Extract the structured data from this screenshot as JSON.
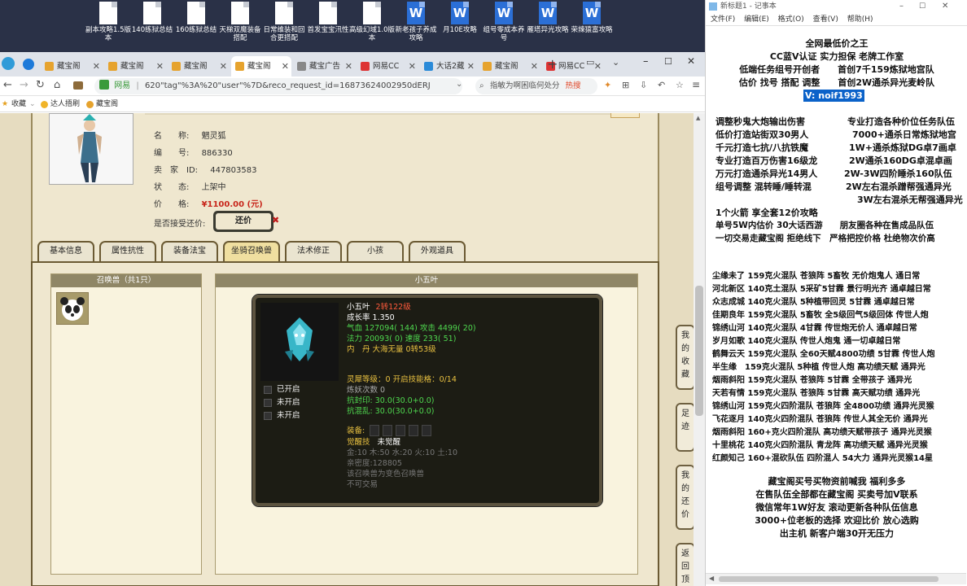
{
  "desktop": {
    "icons": [
      {
        "label": "副本攻略1.5版本",
        "type": "doc"
      },
      {
        "label": "140练狱总结",
        "type": "doc"
      },
      {
        "label": "160练狱总结",
        "type": "doc"
      },
      {
        "label": "天梯双魔装备搭配",
        "type": "doc"
      },
      {
        "label": "日常维装和回合更搭配",
        "type": "doc"
      },
      {
        "label": "首发宝宝汛性",
        "type": "doc"
      },
      {
        "label": "高级幻域1.0版本",
        "type": "doc"
      },
      {
        "label": "新老孩子养成攻略",
        "type": "word"
      },
      {
        "label": "月10E攻略",
        "type": "word"
      },
      {
        "label": "组号零成本养号",
        "type": "word"
      },
      {
        "label": "雁塔异光攻略",
        "type": "word"
      },
      {
        "label": "荣辣猿富攻略",
        "type": "word"
      }
    ]
  },
  "browser": {
    "tabs": [
      {
        "label": "藏宝阁"
      },
      {
        "label": "藏宝阁"
      },
      {
        "label": "藏宝阁"
      },
      {
        "label": "藏宝阁"
      },
      {
        "label": "藏宝广告"
      },
      {
        "label": "网易CC"
      },
      {
        "label": "大话2藏"
      },
      {
        "label": "藏宝阁"
      },
      {
        "label": "网易CC"
      }
    ],
    "new_tab": "+",
    "url": "620\"tag\"%3A%20\"user\"%7D&reco_request_id=16873624002950dERJ",
    "site_label": "网易",
    "search_placeholder": "指敏为啊困临何处分",
    "search_hot": "热搜",
    "bookmarks": {
      "star": "收藏",
      "b1": "达人捂刷",
      "b2": "藏宝阁"
    }
  },
  "item": {
    "name_label": "名　　称:",
    "name_value": "魍灵狐",
    "id_label": "编　　号:",
    "id_value": "886330",
    "seller_label": "卖　家　ID:",
    "seller_value": "447803583",
    "status_label": "状　　态:",
    "status_value": "上架中",
    "price_label": "价　　格:",
    "price_value": "¥1100.00 (元)",
    "counter_label": "是否接受还价:",
    "counter_btn": "还价"
  },
  "game_tabs": [
    "基本信息",
    "属性抗性",
    "装备法宝",
    "坐骑召唤兽",
    "法术修正",
    "小孩",
    "外观道具"
  ],
  "active_tab": "坐骑召唤兽",
  "summon_list": {
    "header": "召唤兽（共1只）"
  },
  "pet": {
    "panel_title": "小五叶",
    "name": "小五叶",
    "level": "2转122级",
    "growth": "成长率 1.350",
    "hp": "气血 127094( 144) 攻击 4499( 20)",
    "mp": "法力 20093( 0) 速度 233( 51)",
    "neidan": "内　丹 大海无量 0转53级",
    "slots": [
      "已开启",
      "未开启",
      "未开启"
    ],
    "spirit": "灵犀等级：0 开启技能格：0/14",
    "refine": "炼妖次数 0",
    "resist1": "抗封印: 30.0(30.0+0.0)",
    "resist2": "抗混乱: 30.0(30.0+0.0)",
    "equip_label": "装备:",
    "awaken_label": "觉醒技",
    "awaken_value": "未觉醒",
    "elements": "金:10 木:50 水:20 火:10 土:10",
    "bonus": "亲密度:128805",
    "note1": "该召唤兽为变色召唤兽",
    "note2": "不可交易"
  },
  "side_buttons": [
    "我的收藏",
    "足迹",
    "我的还价",
    "返回顶部"
  ],
  "notepad": {
    "title": "新标题1 - 记事本",
    "menu": [
      "文件(F)",
      "编辑(E)",
      "格式(O)",
      "查看(V)",
      "帮助(H)"
    ],
    "header_lines": [
      "全网最低价之王",
      "CC蓝V认证 实力担保 老牌工作室",
      "低端任务组号开创者　　首创7千159炼狱地宫队",
      "估价 找号 搭配 调整　　首创2W通杀异光麦岭队"
    ],
    "contact": "V:  noif1993",
    "col_left": [
      "调整秒鬼大炮输出伤害",
      "低价打造站街双30男人",
      "千元打造七抗/八抗铁魔",
      "专业打造百万伤害16级龙",
      "万元打造通杀异光14男人",
      "组号调整 混转睡/睡转混"
    ],
    "col_right": [
      "专业打造各种价位任务队伍",
      "7000+通杀日常炼狱地宫",
      "1W+通杀炼狱DG卓7画卓",
      "2W通杀160DG卓混卓画",
      "2W-3W四阶睡杀160队伍",
      "2W左右混杀蹭帮强通异光",
      "3W左右混杀无帮强通异光"
    ],
    "mid_lines": [
      "1个火箭 享全套12价攻略",
      "单号5W内估价 30大话西游　　朋友圈各种在售成品队伍",
      "一切交易走藏宝阁 拒绝线下　严格把控价格 杜绝物次价高"
    ],
    "listings": [
      "尘缘未了 159克火混队 苍狼阵 5畜牧 无价炮鬼人 通日常",
      "河北新区 140克土混队 5采矿5甘霖 景行明光齐 通卓越日常",
      "众志成城 140克火混队 5种植带回灵 5甘霖 通卓越日常",
      "佳期良年 159克火混队 5畜牧 全5级回气5级回体 传世人炮",
      "锦绣山河 140克火混队 4甘霖 传世炮无价人 通卓越日常",
      "岁月如歌 140克火混队 传世人炮鬼 通一切卓越日常",
      "鹤舞云天 159克火混队 全60天赋4800功绩 5甘霖 传世人炮",
      "半生缘　159克火混队 5种植 传世人炮 高功绩天赋 通异光",
      "烟雨斜阳 159克火混队 苍狼阵 5甘霖 全带孩子 通异光",
      "天若有情 159克火混队 苍狼阵 5甘霖 高天赋功绩 通异光",
      "锦绣山河 159克火四阶混队 苍狼阵 全4800功绩 通异光灵猴",
      "飞花逐月 140克火四阶混队 苍狼阵 传世人其全无价 通异光",
      "烟雨斜阳 160+克火四阶混队 高功绩天赋带孩子 通异光灵猴",
      "十里桃花 140克火四阶混队 青龙阵 高功绩天赋 通异光灵猴",
      "红颜知己 160+混砍队伍 四阶混人 54大力 通异光灵猴14星"
    ],
    "footer_lines": [
      "藏宝阁买号买物资前喊我 福利多多",
      "在售队伍全部都在藏宝阁 买卖号加V联系",
      "微信常年1W好友 滚动更新各种队伍信息",
      "3000+位老板的选择 欢迎比价 放心选购",
      "出主机 新客户端30开无压力"
    ]
  }
}
